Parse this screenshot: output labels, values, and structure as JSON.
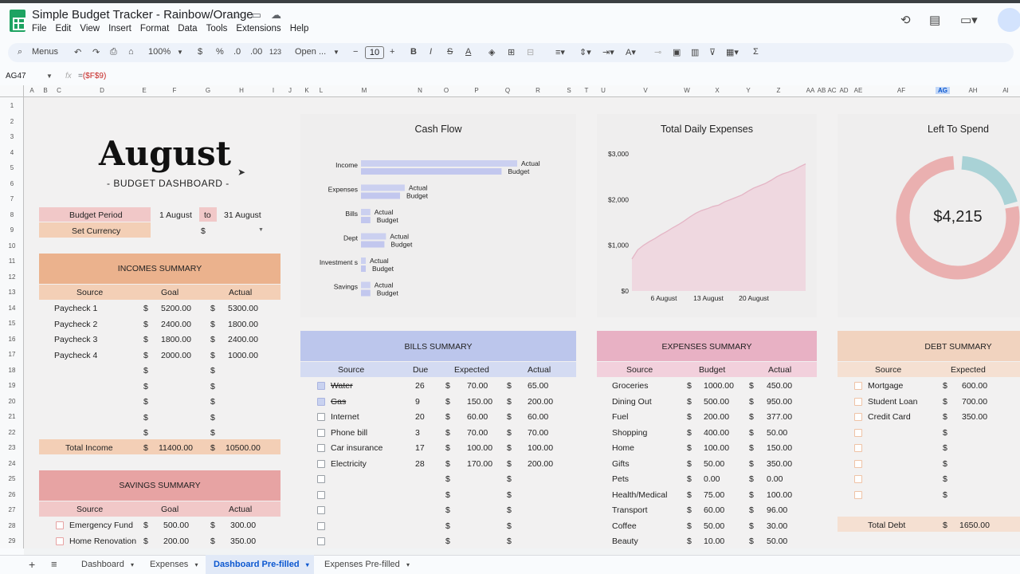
{
  "app": {
    "doc_title": "Simple Budget Tracker - Rainbow/Orange",
    "menu": [
      "File",
      "Edit",
      "View",
      "Insert",
      "Format",
      "Data",
      "Tools",
      "Extensions",
      "Help"
    ]
  },
  "toolbar": {
    "menus_label": "Menus",
    "zoom": "100%",
    "currency": "$",
    "percent": "%",
    "dec_less": ".0",
    "dec_more": ".00",
    "format_num": "123",
    "font": "Open ...",
    "font_size": "10"
  },
  "formula_bar": {
    "cell_ref": "AG47",
    "fx": "fx",
    "formula_eq": "=",
    "formula_ref": "($F$9)"
  },
  "columns": [
    "A",
    "B",
    "C",
    "D",
    "E",
    "F",
    "G",
    "H",
    "I",
    "J",
    "K",
    "L",
    "M",
    "N",
    "O",
    "P",
    "Q",
    "R",
    "S",
    "T",
    "U",
    "V",
    "W",
    "X",
    "Y",
    "Z",
    "AA",
    "AB",
    "AC",
    "AD",
    "AE",
    "AF",
    "AG",
    "AH",
    "AI"
  ],
  "rows": [
    "1",
    "2",
    "3",
    "4",
    "5",
    "6",
    "7",
    "8",
    "9",
    "10",
    "11",
    "12",
    "13",
    "14",
    "15",
    "16",
    "17",
    "18",
    "19",
    "20",
    "21",
    "22",
    "23",
    "24",
    "25",
    "26",
    "27",
    "28",
    "29"
  ],
  "dashboard": {
    "month": "August",
    "subtitle": "- BUDGET DASHBOARD -",
    "budget_period_label": "Budget Period",
    "period_start": "1 August",
    "period_to": "to",
    "period_end": "31 August",
    "currency_label": "Set Currency",
    "currency_value": "$"
  },
  "incomes": {
    "title": "INCOMES SUMMARY",
    "headers": [
      "Source",
      "Goal",
      "Actual"
    ],
    "rows": [
      {
        "source": "Paycheck 1",
        "goal": "5200.00",
        "actual": "5300.00"
      },
      {
        "source": "Paycheck 2",
        "goal": "2400.00",
        "actual": "1800.00"
      },
      {
        "source": "Paycheck 3",
        "goal": "1800.00",
        "actual": "2400.00"
      },
      {
        "source": "Paycheck 4",
        "goal": "2000.00",
        "actual": "1000.00"
      },
      {
        "source": "",
        "goal": "",
        "actual": ""
      },
      {
        "source": "",
        "goal": "",
        "actual": ""
      },
      {
        "source": "",
        "goal": "",
        "actual": ""
      },
      {
        "source": "",
        "goal": "",
        "actual": ""
      },
      {
        "source": "",
        "goal": "",
        "actual": ""
      }
    ],
    "total_label": "Total Income",
    "total_goal": "11400.00",
    "total_actual": "10500.00"
  },
  "savings": {
    "title": "SAVINGS SUMMARY",
    "headers": [
      "Source",
      "Goal",
      "Actual"
    ],
    "rows": [
      {
        "source": "Emergency Fund",
        "goal": "500.00",
        "actual": "300.00"
      },
      {
        "source": "Home Renovation",
        "goal": "200.00",
        "actual": "350.00"
      }
    ]
  },
  "cashflow": {
    "title": "Cash Flow",
    "legend_actual": "Actual",
    "legend_budget": "Budget",
    "categories": [
      {
        "label": "Income",
        "actual": 1,
        "budget": 0.9
      },
      {
        "label": "Expenses",
        "actual": 0.28,
        "budget": 0.25
      },
      {
        "label": "Bills",
        "actual": 0.06,
        "budget": 0.06
      },
      {
        "label": "Dept",
        "actual": 0.16,
        "budget": 0.15
      },
      {
        "label": "Investment s",
        "actual": 0.02,
        "budget": 0.02
      },
      {
        "label": "Savings",
        "actual": 0.06,
        "budget": 0.06
      }
    ]
  },
  "daily_chart": {
    "title": "Total Daily Expenses",
    "y_ticks": [
      "$3,000",
      "$2,000",
      "$1,000",
      "$0"
    ],
    "x_ticks": [
      "6 August",
      "13 August",
      "20 August"
    ]
  },
  "left_to_spend": {
    "title": "Left To Spend",
    "amount": "$4,215",
    "fraction_spent": 0.78
  },
  "bills": {
    "title": "BILLS SUMMARY",
    "headers": [
      "Source",
      "Due",
      "Expected",
      "Actual"
    ],
    "rows": [
      {
        "source": "Water",
        "due": "26",
        "expected": "70.00",
        "actual": "65.00",
        "paid": true
      },
      {
        "source": "Gas",
        "due": "9",
        "expected": "150.00",
        "actual": "200.00",
        "paid": true
      },
      {
        "source": "Internet",
        "due": "20",
        "expected": "60.00",
        "actual": "60.00",
        "paid": false
      },
      {
        "source": "Phone bill",
        "due": "3",
        "expected": "70.00",
        "actual": "70.00",
        "paid": false
      },
      {
        "source": "Car insurance",
        "due": "17",
        "expected": "100.00",
        "actual": "100.00",
        "paid": false
      },
      {
        "source": "Electricity",
        "due": "28",
        "expected": "170.00",
        "actual": "200.00",
        "paid": false
      },
      {
        "source": "",
        "due": "",
        "expected": "",
        "actual": "",
        "paid": false
      },
      {
        "source": "",
        "due": "",
        "expected": "",
        "actual": "",
        "paid": false
      },
      {
        "source": "",
        "due": "",
        "expected": "",
        "actual": "",
        "paid": false
      },
      {
        "source": "",
        "due": "",
        "expected": "",
        "actual": "",
        "paid": false
      },
      {
        "source": "",
        "due": "",
        "expected": "",
        "actual": "",
        "paid": false
      }
    ]
  },
  "expenses": {
    "title": "EXPENSES SUMMARY",
    "headers": [
      "Source",
      "Budget",
      "Actual"
    ],
    "rows": [
      {
        "source": "Groceries",
        "budget": "1000.00",
        "actual": "450.00"
      },
      {
        "source": "Dining Out",
        "budget": "500.00",
        "actual": "950.00"
      },
      {
        "source": "Fuel",
        "budget": "200.00",
        "actual": "377.00"
      },
      {
        "source": "Shopping",
        "budget": "400.00",
        "actual": "50.00"
      },
      {
        "source": "Home",
        "budget": "100.00",
        "actual": "150.00"
      },
      {
        "source": "Gifts",
        "budget": "50.00",
        "actual": "350.00"
      },
      {
        "source": "Pets",
        "budget": "0.00",
        "actual": "0.00"
      },
      {
        "source": "Health/Medical",
        "budget": "75.00",
        "actual": "100.00"
      },
      {
        "source": "Transport",
        "budget": "60.00",
        "actual": "96.00"
      },
      {
        "source": "Coffee",
        "budget": "50.00",
        "actual": "30.00"
      },
      {
        "source": "Beauty",
        "budget": "10.00",
        "actual": "50.00"
      }
    ]
  },
  "debt": {
    "title": "DEBT SUMMARY",
    "headers": [
      "Source",
      "Expected"
    ],
    "rows": [
      {
        "source": "Mortgage",
        "expected": "600.00"
      },
      {
        "source": "Student Loan",
        "expected": "700.00"
      },
      {
        "source": "Credit Card",
        "expected": "350.00"
      },
      {
        "source": "",
        "expected": ""
      },
      {
        "source": "",
        "expected": ""
      },
      {
        "source": "",
        "expected": ""
      },
      {
        "source": "",
        "expected": ""
      },
      {
        "source": "",
        "expected": ""
      }
    ],
    "total_label": "Total Debt",
    "total_expected": "1650.00"
  },
  "sheets": [
    {
      "name": "Dashboard",
      "active": false
    },
    {
      "name": "Expenses",
      "active": false
    },
    {
      "name": "Dashboard Pre-filled",
      "active": true
    },
    {
      "name": "Expenses Pre-filled",
      "active": false
    }
  ],
  "colors": {
    "accent": "#1a73e8",
    "incomes": "#ebb28d",
    "savings": "#e7a3a3",
    "bills": "#bcc6ec",
    "expenses": "#e8b1c4",
    "debt": "#f1d3bf",
    "donut_spent": "#eab0b0",
    "donut_left": "#a9d2d6"
  }
}
